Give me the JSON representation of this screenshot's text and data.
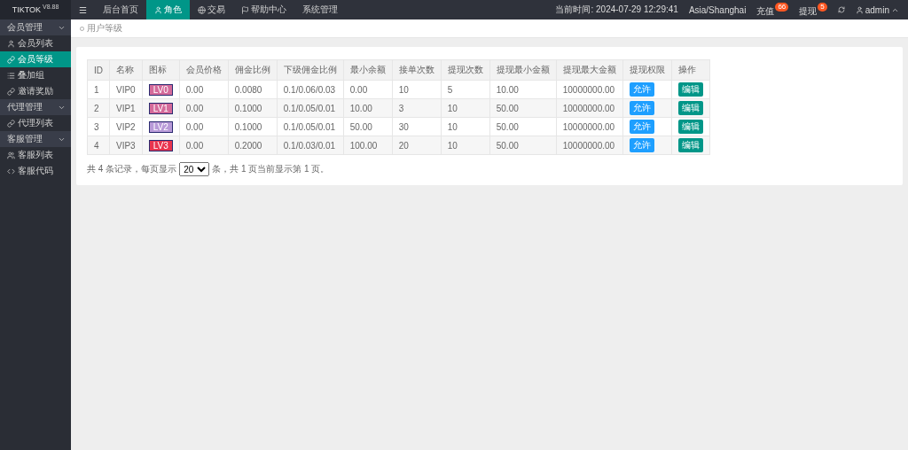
{
  "brand": {
    "name": "TIKTOK",
    "version": "V8.88"
  },
  "top_nav": [
    {
      "label": "☰",
      "kind": "menu",
      "selected": false
    },
    {
      "label": "后台首页",
      "kind": "text",
      "selected": false
    },
    {
      "label": "角色",
      "kind": "user",
      "selected": true
    },
    {
      "label": "交易",
      "kind": "globe",
      "selected": false
    },
    {
      "label": "帮助中心",
      "kind": "flag",
      "selected": false
    },
    {
      "label": "系统管理",
      "kind": "text",
      "selected": false
    }
  ],
  "top_right": {
    "time": "当前时间: 2024-07-29 12:29:41",
    "timezone": "Asia/Shanghai",
    "actions": [
      {
        "label": "充值",
        "badge": "66"
      },
      {
        "label": "提现",
        "badge": "5"
      }
    ],
    "user": "admin"
  },
  "sidebar": [
    {
      "label": "会员管理",
      "expanded": true,
      "children": [
        {
          "label": "会员列表",
          "kind": "user",
          "selected": false
        },
        {
          "label": "会员等级",
          "kind": "link",
          "selected": true
        },
        {
          "label": "叠加组",
          "kind": "list",
          "selected": false
        },
        {
          "label": "邀请奖励",
          "kind": "link",
          "selected": false
        }
      ]
    },
    {
      "label": "代理管理",
      "expanded": true,
      "children": [
        {
          "label": "代理列表",
          "kind": "link",
          "selected": false
        }
      ]
    },
    {
      "label": "客服管理",
      "expanded": true,
      "children": [
        {
          "label": "客服列表",
          "kind": "users",
          "selected": false
        },
        {
          "label": "客服代码",
          "kind": "code",
          "selected": false
        }
      ]
    }
  ],
  "breadcrumb": "用户等级",
  "table": {
    "columns": [
      "ID",
      "名称",
      "图标",
      "会员价格",
      "佣金比例",
      "下级佣金比例",
      "最小余额",
      "接单次数",
      "提现次数",
      "提现最小金额",
      "提现最大金额",
      "提现权限",
      "操作"
    ],
    "rows": [
      {
        "cells": [
          "1",
          "VIP0"
        ],
        "icon": {
          "text": "LV0",
          "color": "#d46a9a"
        },
        "values": [
          "0.00",
          "0.0080",
          "0.1/0.06/0.03",
          "0.00",
          "10",
          "5",
          "10.00",
          "10000000.00"
        ],
        "permission": "允许",
        "action": "编辑"
      },
      {
        "cells": [
          "2",
          "VIP1"
        ],
        "icon": {
          "text": "LV1",
          "color": "#d46a9a"
        },
        "values": [
          "0.00",
          "0.1000",
          "0.1/0.05/0.01",
          "10.00",
          "3",
          "10",
          "50.00",
          "10000000.00"
        ],
        "permission": "允许",
        "action": "编辑"
      },
      {
        "cells": [
          "3",
          "VIP2"
        ],
        "icon": {
          "text": "LV2",
          "color": "#b89ad8"
        },
        "values": [
          "0.00",
          "0.1000",
          "0.1/0.05/0.01",
          "50.00",
          "30",
          "10",
          "50.00",
          "10000000.00"
        ],
        "permission": "允许",
        "action": "编辑"
      },
      {
        "cells": [
          "4",
          "VIP3"
        ],
        "icon": {
          "text": "LV3",
          "color": "#e8344e"
        },
        "values": [
          "0.00",
          "0.2000",
          "0.1/0.03/0.01",
          "100.00",
          "20",
          "10",
          "50.00",
          "10000000.00"
        ],
        "permission": "允许",
        "action": "编辑"
      }
    ]
  },
  "pagination": {
    "before": "共 4 条记录，每页显示",
    "page_size": "20",
    "after": "条，共 1 页当前显示第 1 页。"
  }
}
